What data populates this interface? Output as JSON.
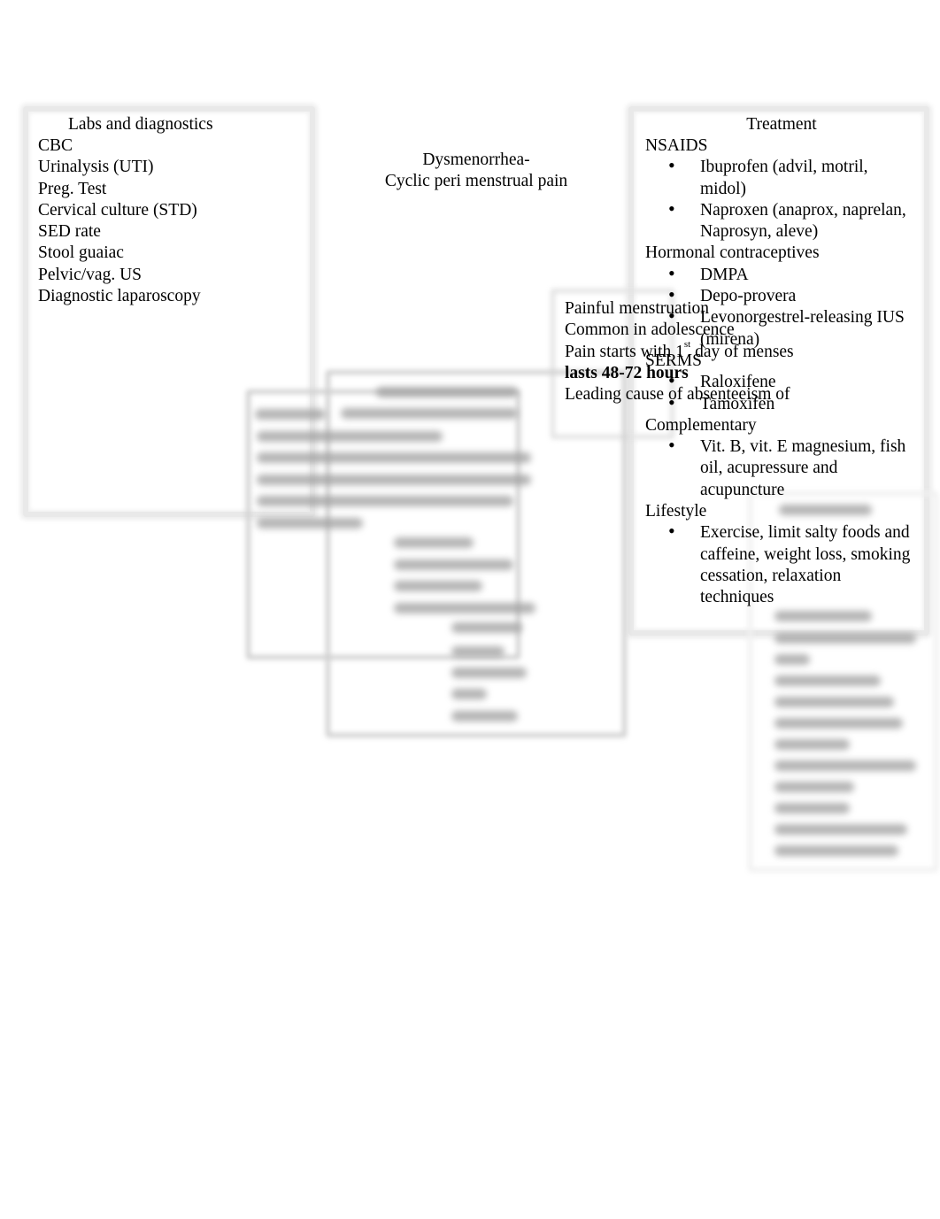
{
  "center": {
    "title_line1": "Dysmenorrhea-",
    "title_line2": "Cyclic peri menstrual pain"
  },
  "labs": {
    "heading": "Labs and diagnostics",
    "items": [
      "CBC",
      "Urinalysis (UTI)",
      "Preg. Test",
      "Cervical culture (STD)",
      "SED rate",
      "Stool guaiac",
      "Pelvic/vag. US",
      "Diagnostic laparoscopy"
    ]
  },
  "definition": {
    "lines": [
      "Painful menstruation",
      "Common in adolescence"
    ],
    "pain_start_prefix": "Pain starts with 1",
    "pain_start_sup": "st",
    "pain_start_suffix": " day of menses",
    "bold_line": "lasts 48-72 hours",
    "last_line": "Leading cause of absenteeism of"
  },
  "treatment": {
    "heading": "Treatment",
    "groups": [
      {
        "label": "NSAIDS",
        "items": [
          "Ibuprofen (advil, motril, midol)",
          "Naproxen (anaprox, naprelan, Naprosyn, aleve)"
        ]
      },
      {
        "label": "Hormonal contraceptives",
        "items": [
          "DMPA",
          "Depo-provera",
          "Levonorgestrel-releasing IUS (mirena)"
        ]
      },
      {
        "label": "SERMS",
        "items": [
          "Raloxifene",
          "Tamoxifen"
        ]
      },
      {
        "label": "Complementary",
        "items": [
          "Vit. B, vit. E magnesium, fish oil, acupressure and acupuncture"
        ]
      },
      {
        "label": "Lifestyle",
        "items": [
          "Exercise, limit salty foods and caffeine, weight loss, smoking cessation, relaxation techniques"
        ]
      }
    ]
  }
}
